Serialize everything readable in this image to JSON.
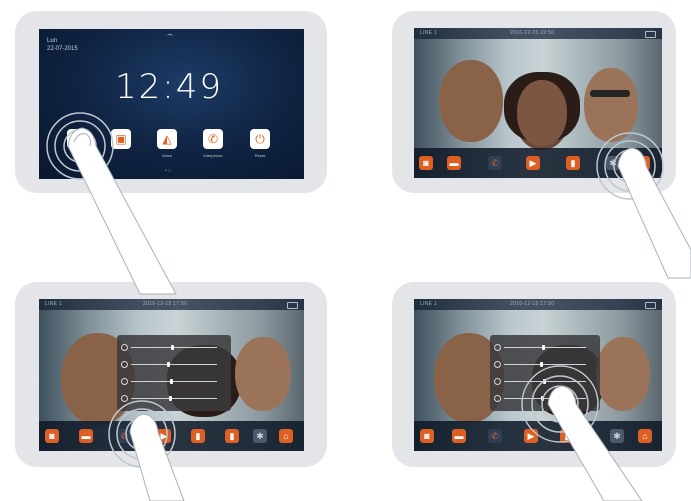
{
  "home_screen": {
    "day": "Lun",
    "date": "22-07-2015",
    "time": "12:49",
    "apps": [
      {
        "icon": "doorbell-icon",
        "label": ""
      },
      {
        "icon": "camera-icon",
        "label": ""
      },
      {
        "icon": "video-icon",
        "label": "Video"
      },
      {
        "icon": "phone-icon",
        "label": "Interphone"
      },
      {
        "icon": "power-icon",
        "label": "Reset"
      }
    ],
    "page_indicator": "• ○"
  },
  "video_screens": [
    {
      "channel": "LINE 1",
      "datetime": "2016-12-15  22:50"
    },
    {
      "channel": "LINE 1",
      "datetime": "2016-12-15  17:50"
    },
    {
      "channel": "LINE 1",
      "datetime": "2016-12-15  17:50"
    }
  ],
  "colors": {
    "accent": "#de5f24",
    "frame": "#e3e5e9",
    "screen_dark": "#0f2240"
  }
}
